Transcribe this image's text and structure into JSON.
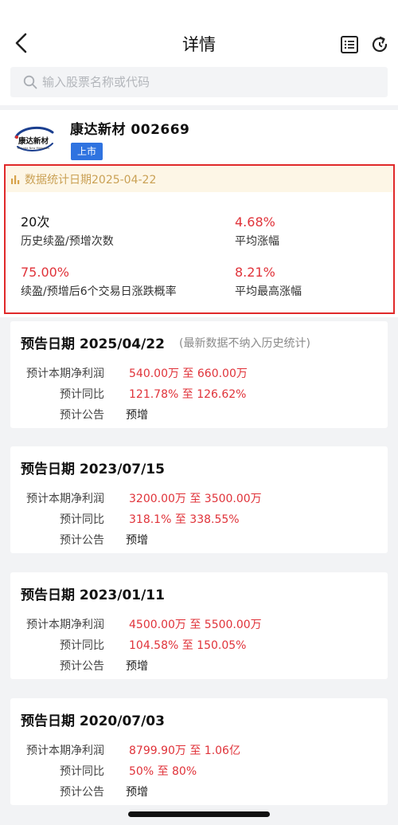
{
  "header": {
    "title": "详情",
    "back_icon": "back-arrow-icon",
    "list_icon": "list-icon",
    "refresh_icon": "refresh-icon"
  },
  "search": {
    "placeholder": "输入股票名称或代码",
    "value": ""
  },
  "stock": {
    "name_code": "康达新材 002669",
    "logo_name": "康达新材",
    "logo_en": "Kangda New Materials",
    "tag": "上市"
  },
  "stats": {
    "date_label": "数据统计日期2025-04-22",
    "items": [
      {
        "value": "20次",
        "label": "历史续盈/预增次数",
        "color": "black"
      },
      {
        "value": "4.68%",
        "label": "平均涨幅",
        "color": "red"
      },
      {
        "value": "75.00%",
        "label": "续盈/预增后6个交易日涨跌概率",
        "color": "red"
      },
      {
        "value": "8.21%",
        "label": "平均最高涨幅",
        "color": "red"
      }
    ]
  },
  "labels": {
    "profit": "预计本期净利润",
    "yoy": "预计同比",
    "announcement": "预计公告"
  },
  "forecasts": [
    {
      "title": "预告日期 2025/04/22",
      "note": "(最新数据不纳入历史统计)",
      "profit": "540.00万 至 660.00万",
      "yoy": "121.78% 至 126.62%",
      "type": "预增"
    },
    {
      "title": "预告日期 2023/07/15",
      "note": "",
      "profit": "3200.00万 至 3500.00万",
      "yoy": "318.1% 至 338.55%",
      "type": "预增"
    },
    {
      "title": "预告日期 2023/01/11",
      "note": "",
      "profit": "4500.00万 至 5500.00万",
      "yoy": "104.58% 至 150.05%",
      "type": "预增"
    },
    {
      "title": "预告日期 2020/07/03",
      "note": "",
      "profit": "8799.90万 至 1.06亿",
      "yoy": "50% 至 80%",
      "type": "预增"
    }
  ],
  "colors": {
    "accent_red": "#e0333a",
    "highlight_border": "#e0292a",
    "tag_blue": "#2f73e0",
    "date_gold": "#caa155"
  }
}
